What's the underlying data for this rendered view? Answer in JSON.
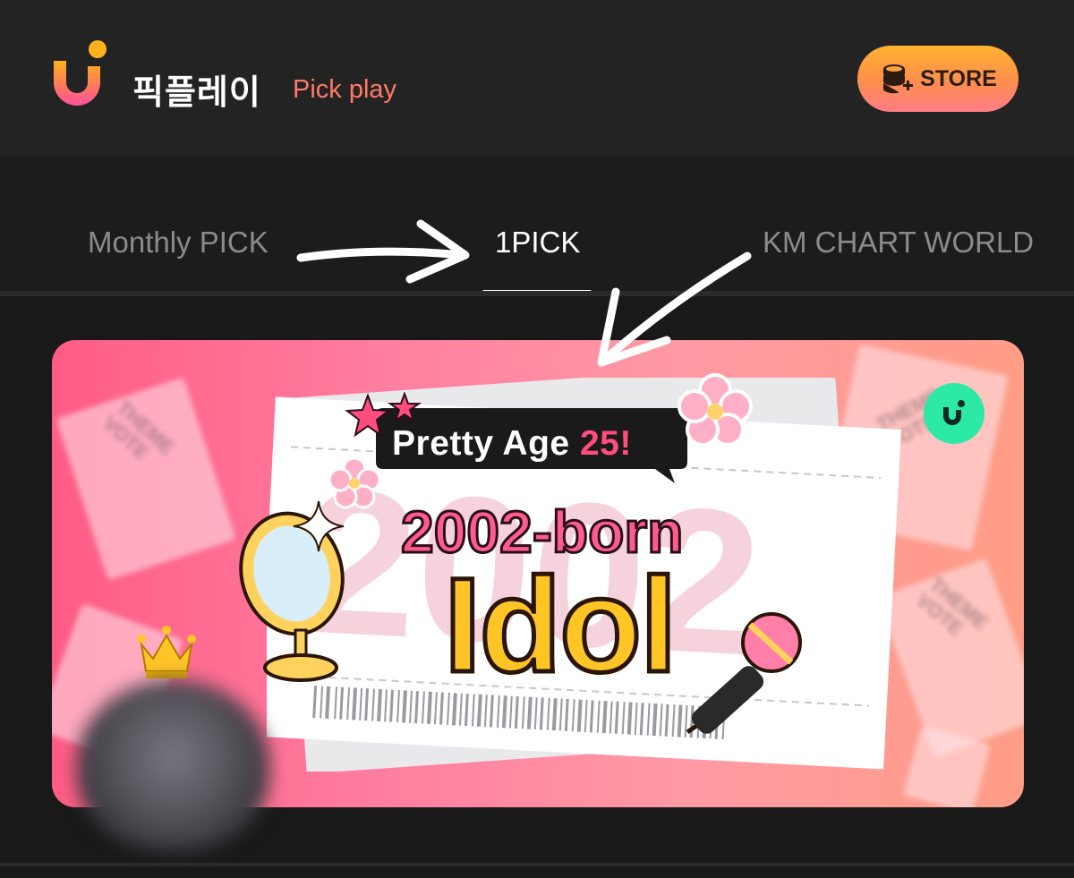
{
  "header": {
    "app_name": "픽플레이",
    "app_subtitle": "Pick play",
    "store_label": "STORE",
    "logo_icon": "pickplay-logo-icon",
    "store_icon": "coin-stack-plus-icon",
    "colors": {
      "accent": "#ff7a66",
      "store_gradient_top": "#ffb22e",
      "store_gradient_bottom": "#ff7d86"
    }
  },
  "tabs": [
    {
      "label": "Monthly PICK",
      "active": false
    },
    {
      "label": "1PICK",
      "active": true
    },
    {
      "label": "KM CHART WORLD",
      "active": false
    }
  ],
  "banner": {
    "tagline_prefix": "Pretty Age ",
    "tagline_number": "25!",
    "headline": "2002-born",
    "title": "Idol",
    "bg_year": "2002",
    "bg_ticket_text": "THEME VOTE",
    "icons": [
      "mirror-icon",
      "microphone-icon",
      "cherry-blossom-icon",
      "star-icon",
      "crown-icon",
      "sparkle-icon"
    ],
    "colors": {
      "pink": "#ff5c86",
      "yellow": "#ffc527",
      "badge": "#2de9a6"
    }
  }
}
